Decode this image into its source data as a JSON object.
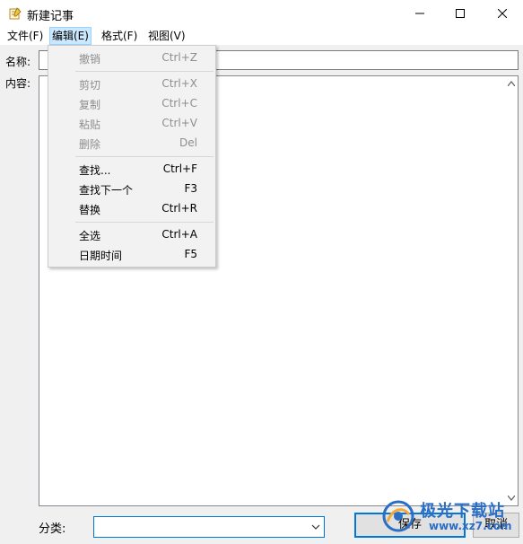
{
  "window": {
    "title": "新建记事",
    "icon": "note-edit-icon"
  },
  "menubar": [
    {
      "label": "文件(F)"
    },
    {
      "label": "编辑(E)",
      "active": true
    },
    {
      "label": "格式(F)"
    },
    {
      "label": "视图(V)"
    }
  ],
  "form": {
    "name_label": "名称:",
    "content_label": "内容:",
    "category_label": "分类:",
    "category_value": "",
    "save_label": "保存",
    "cancel_label": "取消"
  },
  "edit_menu": {
    "groups": [
      [
        {
          "label": "撤销",
          "shortcut": "Ctrl+Z",
          "enabled": false
        }
      ],
      [
        {
          "label": "剪切",
          "shortcut": "Ctrl+X",
          "enabled": false
        },
        {
          "label": "复制",
          "shortcut": "Ctrl+C",
          "enabled": false
        },
        {
          "label": "粘贴",
          "shortcut": "Ctrl+V",
          "enabled": false
        },
        {
          "label": "删除",
          "shortcut": "Del",
          "enabled": false
        }
      ],
      [
        {
          "label": "查找...",
          "shortcut": "Ctrl+F",
          "enabled": true
        },
        {
          "label": "查找下一个",
          "shortcut": "F3",
          "enabled": true
        },
        {
          "label": "替换",
          "shortcut": "Ctrl+R",
          "enabled": true
        }
      ],
      [
        {
          "label": "全选",
          "shortcut": "Ctrl+A",
          "enabled": true
        },
        {
          "label": "日期时间",
          "shortcut": "F5",
          "enabled": true
        }
      ]
    ]
  },
  "watermark": {
    "name": "极光下载站",
    "url": "www.xz7.com"
  },
  "colors": {
    "accent": "#0078d7",
    "menu_highlight": "#cce8ff",
    "disabled_text": "#8e8e8e",
    "watermark": "#2a6ec6"
  }
}
